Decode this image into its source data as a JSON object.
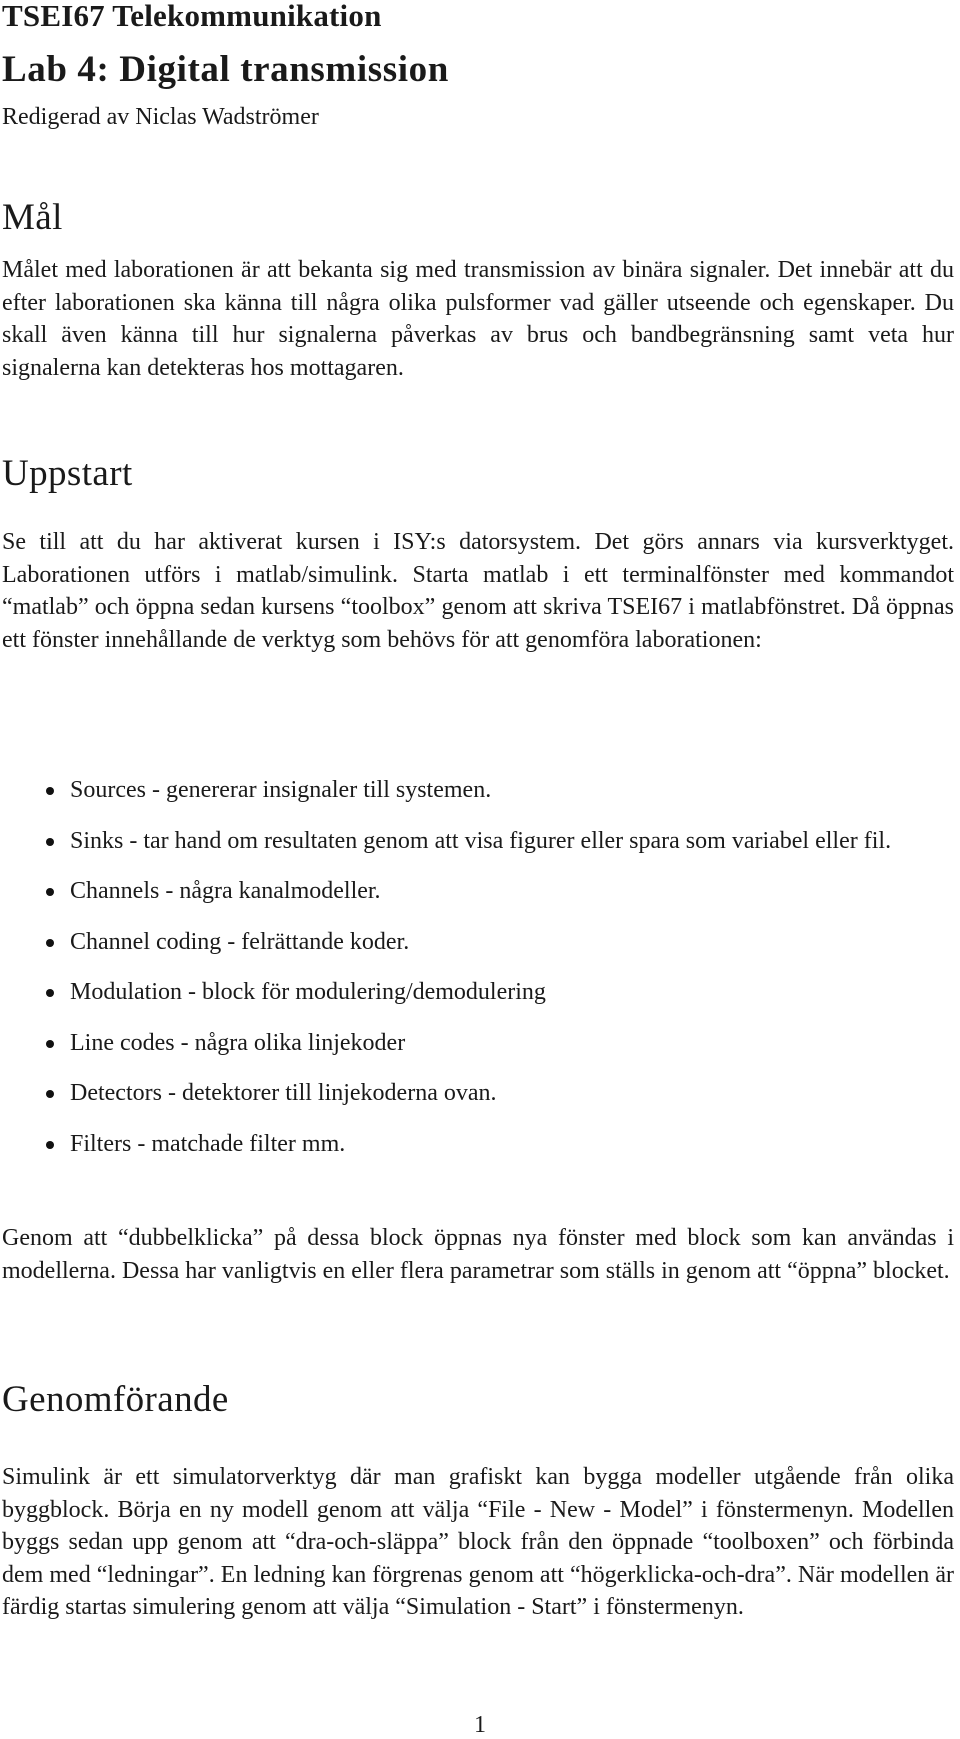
{
  "document": {
    "course_title": "TSEI67 Telekommunikation",
    "lab_title": "Lab 4: Digital transmission",
    "author": "Redigerad av Niclas Wadströmer",
    "sections": [
      {
        "heading": "Mål",
        "paragraphs": [
          "Målet med laborationen är att bekanta sig med transmission av binära signaler. Det innebär att du efter laborationen ska känna till några olika pulsformer vad gäller utseende och egenskaper. Du skall även känna till hur signalerna påverkas av brus och bandbegränsning samt veta hur signalerna kan detekteras hos mottagaren."
        ]
      },
      {
        "heading": "Uppstart",
        "paragraphs": [
          "Se till att du har aktiverat kursen i ISY:s datorsystem. Det görs annars via kursverktyget. Laborationen utförs i matlab/simulink. Starta matlab i ett ter­minalfönster med kommandot “matlab” och öppna sedan kursens “toolbox” ge­nom att skriva TSEI67 i matlabfönstret. Då öppnas ett fönster innehållande de verktyg som behövs för att genomföra laborationen:",
          "Genom att “dubbelklicka” på dessa block öppnas nya fönster med block som kan användas i modellerna. Dessa har vanligtvis en eller flera parametrar som ställs in genom att “öppna” blocket."
        ],
        "bullets": [
          "Sources - genererar insignaler till systemen.",
          "Sinks - tar hand om resultaten genom att visa figurer eller spara som variabel eller fil.",
          "Channels - några kanalmodeller.",
          "Channel coding - felrättande koder.",
          "Modulation - block för modulering/demodulering",
          "Line codes - några olika linjekoder",
          "Detectors - detektorer till linjekoderna ovan.",
          "Filters - matchade filter mm."
        ]
      },
      {
        "heading": "Genomförande",
        "paragraphs": [
          "Simulink är ett simulatorverktyg där man grafiskt kan bygga modeller utgående från olika byggblock. Börja en ny modell genom att välja “File - New - Model” i fönstermenyn. Modellen byggs sedan upp genom att “dra-och-släppa” block från den öppnade “toolboxen” och förbinda dem med “ledningar”. En ledning kan förgrenas genom att “högerklicka-och-dra”. När modellen är färdig startas simulering genom att välja “Simulation - Start” i fönstermenyn."
        ]
      }
    ],
    "page_number": "1"
  }
}
